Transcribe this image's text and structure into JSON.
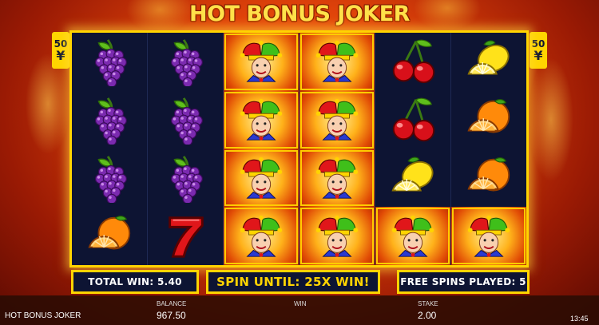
{
  "game": {
    "title": "HOT BONUS JOKER",
    "lines_left": "50",
    "lines_right": "50",
    "lines_icon": "¥"
  },
  "reels": [
    [
      "grapes",
      "grapes",
      "grapes",
      "orange"
    ],
    [
      "grapes",
      "grapes",
      "grapes",
      "seven"
    ],
    [
      "joker",
      "joker",
      "joker",
      "joker"
    ],
    [
      "joker",
      "joker",
      "joker",
      "joker"
    ],
    [
      "cherry",
      "cherry",
      "lemon",
      "joker"
    ],
    [
      "lemon",
      "orange",
      "orange",
      "joker"
    ]
  ],
  "info": {
    "total_win": "TOTAL WIN: 5.40",
    "spin_until": "SPIN UNTIL: 25X WIN!",
    "free_spins": "FREE SPINS PLAYED: 5"
  },
  "bottom": {
    "game_name": "HOT BONUS JOKER",
    "balance_label": "BALANCE",
    "balance_value": "967.50",
    "win_label": "WIN",
    "stake_label": "STAKE",
    "stake_value": "2.00",
    "clock": "13:45"
  },
  "colors": {
    "frame": "#ffd400",
    "reel_bg": "#0d1433",
    "title": "#ffe14a"
  }
}
